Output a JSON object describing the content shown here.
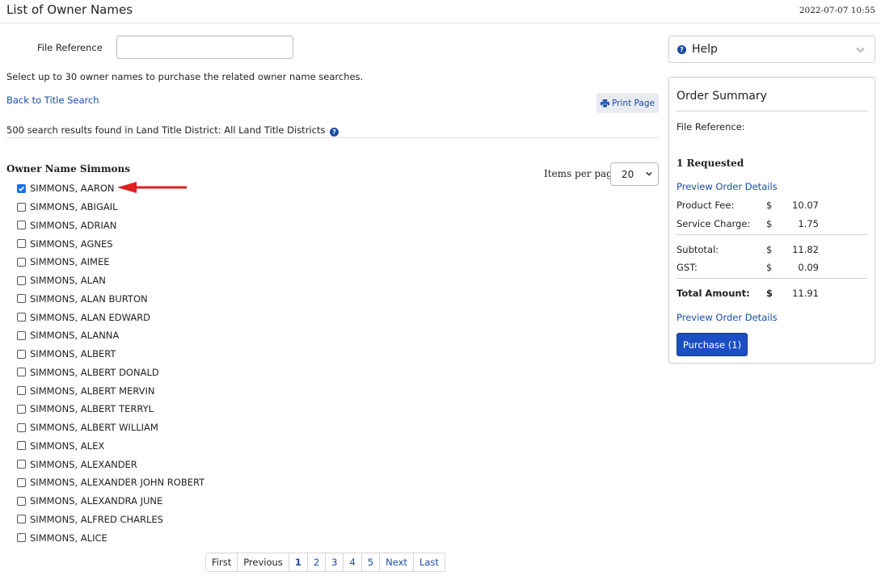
{
  "header": {
    "title": "List of Owner Names",
    "timestamp": "2022-07-07 10:55"
  },
  "form": {
    "file_reference_label": "File Reference",
    "file_reference_value": "",
    "instructions": "Select up to 30 owner names to purchase the related owner name searches.",
    "back_link": "Back to Title Search",
    "print_button": "Print Page",
    "results_text": "500 search results found in Land Title District: All Land Title Districts"
  },
  "owners": {
    "heading": "Owner Name Simmons",
    "items_per_page_label": "Items per page",
    "items_per_page_value": "20",
    "list": [
      {
        "name": "SIMMONS, AARON",
        "checked": true
      },
      {
        "name": "SIMMONS, ABIGAIL",
        "checked": false
      },
      {
        "name": "SIMMONS, ADRIAN",
        "checked": false
      },
      {
        "name": "SIMMONS, AGNES",
        "checked": false
      },
      {
        "name": "SIMMONS, AIMEE",
        "checked": false
      },
      {
        "name": "SIMMONS, ALAN",
        "checked": false
      },
      {
        "name": "SIMMONS, ALAN BURTON",
        "checked": false
      },
      {
        "name": "SIMMONS, ALAN EDWARD",
        "checked": false
      },
      {
        "name": "SIMMONS, ALANNA",
        "checked": false
      },
      {
        "name": "SIMMONS, ALBERT",
        "checked": false
      },
      {
        "name": "SIMMONS, ALBERT DONALD",
        "checked": false
      },
      {
        "name": "SIMMONS, ALBERT MERVIN",
        "checked": false
      },
      {
        "name": "SIMMONS, ALBERT TERRYL",
        "checked": false
      },
      {
        "name": "SIMMONS, ALBERT WILLIAM",
        "checked": false
      },
      {
        "name": "SIMMONS, ALEX",
        "checked": false
      },
      {
        "name": "SIMMONS, ALEXANDER",
        "checked": false
      },
      {
        "name": "SIMMONS, ALEXANDER JOHN ROBERT",
        "checked": false
      },
      {
        "name": "SIMMONS, ALEXANDRA JUNE",
        "checked": false
      },
      {
        "name": "SIMMONS, ALFRED CHARLES",
        "checked": false
      },
      {
        "name": "SIMMONS, ALICE",
        "checked": false
      }
    ]
  },
  "pagination": {
    "first": "First",
    "previous": "Previous",
    "pages": [
      "1",
      "2",
      "3",
      "4",
      "5"
    ],
    "current": "1",
    "next": "Next",
    "last": "Last"
  },
  "help": {
    "title": "Help"
  },
  "order_summary": {
    "title": "Order Summary",
    "file_reference_label": "File Reference:",
    "requested": "1 Requested",
    "preview_link": "Preview Order Details",
    "currency": "$",
    "product_fee_label": "Product Fee:",
    "product_fee": "10.07",
    "service_charge_label": "Service Charge:",
    "service_charge": "1.75",
    "subtotal_label": "Subtotal:",
    "subtotal": "11.82",
    "gst_label": "GST:",
    "gst": "0.09",
    "total_label": "Total Amount:",
    "total": "11.91",
    "purchase_button": "Purchase (1)"
  },
  "colors": {
    "link": "#1a4ca3",
    "primary_button": "#1c4ec4",
    "checkbox_checked": "#1a73e8",
    "annotation_arrow": "#e02020"
  }
}
